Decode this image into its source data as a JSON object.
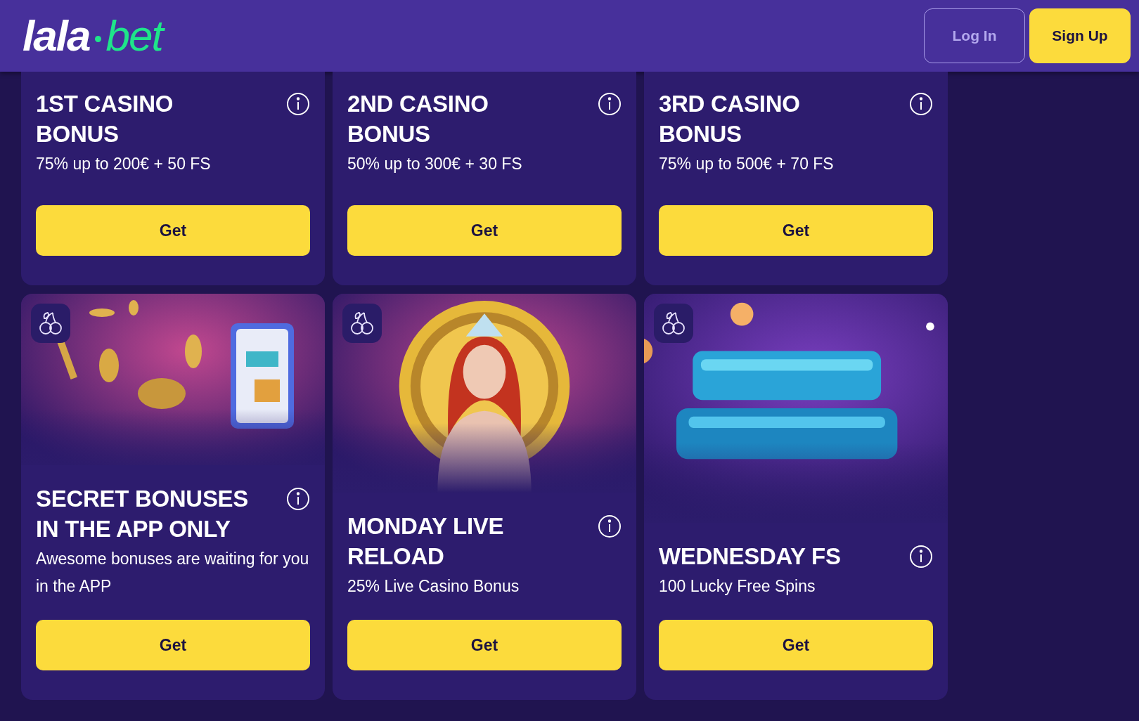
{
  "header": {
    "logo": {
      "left": "lala",
      "right": "bet"
    },
    "buttons": [
      {
        "label": "Log In",
        "kind": "outline"
      },
      {
        "label": "Sign Up",
        "kind": "primary"
      }
    ]
  },
  "bonuses": [
    {
      "kind": "text",
      "title": "1ST CASINO BONUS",
      "subtitle": "75% up to 200€ + 50 FS",
      "button": "Get"
    },
    {
      "kind": "text",
      "title": "2ND CASINO BONUS",
      "subtitle": "50% up to 300€ + 30 FS",
      "button": "Get"
    },
    {
      "kind": "text",
      "title": "3RD CASINO BONUS",
      "subtitle": "75% up to 500€ + 70 FS",
      "button": "Get"
    },
    {
      "title": "SECRET BONUSES IN THE APP ONLY",
      "subtitle": "Awesome bonuses are waiting for you in the APP",
      "button": "Get"
    },
    {
      "title": "MONDAY LIVE RELOAD",
      "subtitle": "25% Live Casino Bonus",
      "button": "Get"
    },
    {
      "title": "WEDNESDAY FS",
      "subtitle": "100 Lucky Free Spins",
      "button": "Get"
    }
  ]
}
